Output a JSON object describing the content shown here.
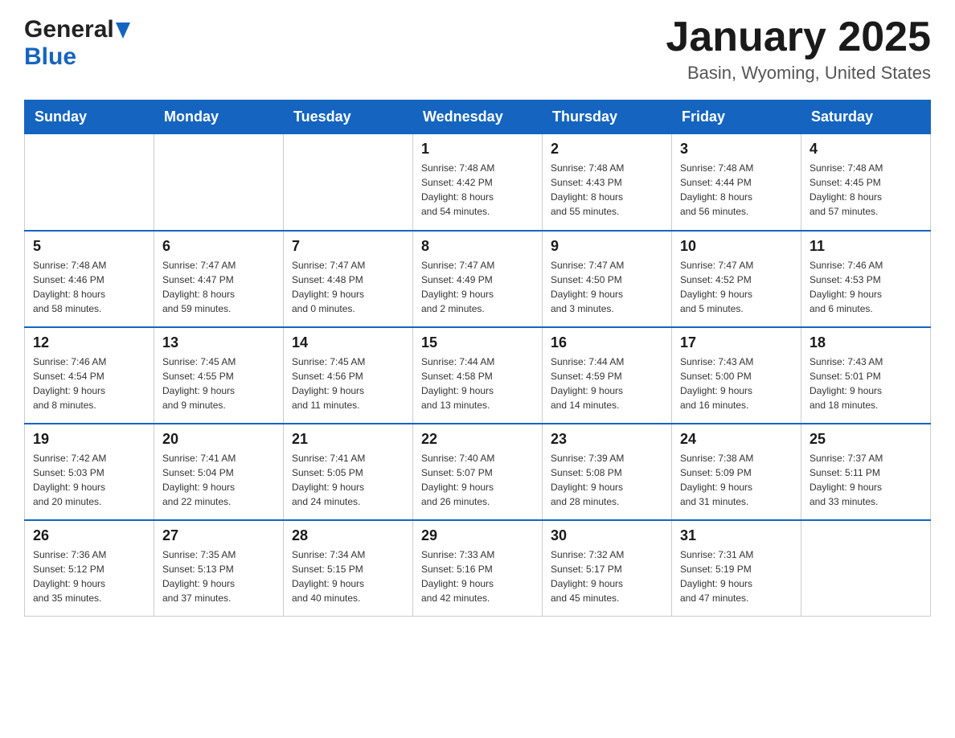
{
  "header": {
    "logo_general": "General",
    "logo_blue": "Blue",
    "month_title": "January 2025",
    "location": "Basin, Wyoming, United States"
  },
  "days_of_week": [
    "Sunday",
    "Monday",
    "Tuesday",
    "Wednesday",
    "Thursday",
    "Friday",
    "Saturday"
  ],
  "weeks": [
    [
      {
        "day": "",
        "info": ""
      },
      {
        "day": "",
        "info": ""
      },
      {
        "day": "",
        "info": ""
      },
      {
        "day": "1",
        "info": "Sunrise: 7:48 AM\nSunset: 4:42 PM\nDaylight: 8 hours\nand 54 minutes."
      },
      {
        "day": "2",
        "info": "Sunrise: 7:48 AM\nSunset: 4:43 PM\nDaylight: 8 hours\nand 55 minutes."
      },
      {
        "day": "3",
        "info": "Sunrise: 7:48 AM\nSunset: 4:44 PM\nDaylight: 8 hours\nand 56 minutes."
      },
      {
        "day": "4",
        "info": "Sunrise: 7:48 AM\nSunset: 4:45 PM\nDaylight: 8 hours\nand 57 minutes."
      }
    ],
    [
      {
        "day": "5",
        "info": "Sunrise: 7:48 AM\nSunset: 4:46 PM\nDaylight: 8 hours\nand 58 minutes."
      },
      {
        "day": "6",
        "info": "Sunrise: 7:47 AM\nSunset: 4:47 PM\nDaylight: 8 hours\nand 59 minutes."
      },
      {
        "day": "7",
        "info": "Sunrise: 7:47 AM\nSunset: 4:48 PM\nDaylight: 9 hours\nand 0 minutes."
      },
      {
        "day": "8",
        "info": "Sunrise: 7:47 AM\nSunset: 4:49 PM\nDaylight: 9 hours\nand 2 minutes."
      },
      {
        "day": "9",
        "info": "Sunrise: 7:47 AM\nSunset: 4:50 PM\nDaylight: 9 hours\nand 3 minutes."
      },
      {
        "day": "10",
        "info": "Sunrise: 7:47 AM\nSunset: 4:52 PM\nDaylight: 9 hours\nand 5 minutes."
      },
      {
        "day": "11",
        "info": "Sunrise: 7:46 AM\nSunset: 4:53 PM\nDaylight: 9 hours\nand 6 minutes."
      }
    ],
    [
      {
        "day": "12",
        "info": "Sunrise: 7:46 AM\nSunset: 4:54 PM\nDaylight: 9 hours\nand 8 minutes."
      },
      {
        "day": "13",
        "info": "Sunrise: 7:45 AM\nSunset: 4:55 PM\nDaylight: 9 hours\nand 9 minutes."
      },
      {
        "day": "14",
        "info": "Sunrise: 7:45 AM\nSunset: 4:56 PM\nDaylight: 9 hours\nand 11 minutes."
      },
      {
        "day": "15",
        "info": "Sunrise: 7:44 AM\nSunset: 4:58 PM\nDaylight: 9 hours\nand 13 minutes."
      },
      {
        "day": "16",
        "info": "Sunrise: 7:44 AM\nSunset: 4:59 PM\nDaylight: 9 hours\nand 14 minutes."
      },
      {
        "day": "17",
        "info": "Sunrise: 7:43 AM\nSunset: 5:00 PM\nDaylight: 9 hours\nand 16 minutes."
      },
      {
        "day": "18",
        "info": "Sunrise: 7:43 AM\nSunset: 5:01 PM\nDaylight: 9 hours\nand 18 minutes."
      }
    ],
    [
      {
        "day": "19",
        "info": "Sunrise: 7:42 AM\nSunset: 5:03 PM\nDaylight: 9 hours\nand 20 minutes."
      },
      {
        "day": "20",
        "info": "Sunrise: 7:41 AM\nSunset: 5:04 PM\nDaylight: 9 hours\nand 22 minutes."
      },
      {
        "day": "21",
        "info": "Sunrise: 7:41 AM\nSunset: 5:05 PM\nDaylight: 9 hours\nand 24 minutes."
      },
      {
        "day": "22",
        "info": "Sunrise: 7:40 AM\nSunset: 5:07 PM\nDaylight: 9 hours\nand 26 minutes."
      },
      {
        "day": "23",
        "info": "Sunrise: 7:39 AM\nSunset: 5:08 PM\nDaylight: 9 hours\nand 28 minutes."
      },
      {
        "day": "24",
        "info": "Sunrise: 7:38 AM\nSunset: 5:09 PM\nDaylight: 9 hours\nand 31 minutes."
      },
      {
        "day": "25",
        "info": "Sunrise: 7:37 AM\nSunset: 5:11 PM\nDaylight: 9 hours\nand 33 minutes."
      }
    ],
    [
      {
        "day": "26",
        "info": "Sunrise: 7:36 AM\nSunset: 5:12 PM\nDaylight: 9 hours\nand 35 minutes."
      },
      {
        "day": "27",
        "info": "Sunrise: 7:35 AM\nSunset: 5:13 PM\nDaylight: 9 hours\nand 37 minutes."
      },
      {
        "day": "28",
        "info": "Sunrise: 7:34 AM\nSunset: 5:15 PM\nDaylight: 9 hours\nand 40 minutes."
      },
      {
        "day": "29",
        "info": "Sunrise: 7:33 AM\nSunset: 5:16 PM\nDaylight: 9 hours\nand 42 minutes."
      },
      {
        "day": "30",
        "info": "Sunrise: 7:32 AM\nSunset: 5:17 PM\nDaylight: 9 hours\nand 45 minutes."
      },
      {
        "day": "31",
        "info": "Sunrise: 7:31 AM\nSunset: 5:19 PM\nDaylight: 9 hours\nand 47 minutes."
      },
      {
        "day": "",
        "info": ""
      }
    ]
  ]
}
